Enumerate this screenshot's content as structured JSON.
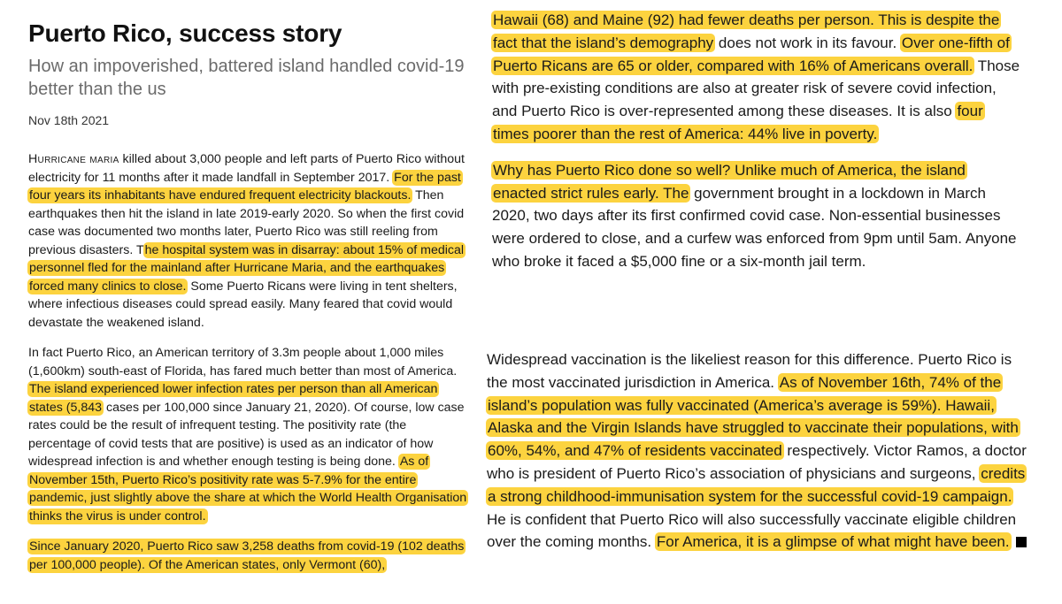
{
  "article": {
    "title": "Puerto Rico, success story",
    "subtitle": "How an impoverished, battered island handled covid-19 better than the us",
    "date": "Nov 18th 2021"
  },
  "p1": {
    "dropcap": "Hurricane maria",
    "t1": " killed about 3,000 people and left parts of Puerto Rico without electricity for 11 months after it made landfall in September 2017. ",
    "h1": "For the past four years its inhabitants have endured frequent electricity blackouts.",
    "t2": " Then earthquakes then hit the island in late 2019-early 2020. So when the first covid case was documented two months later, Puerto Rico was still reeling from previous disasters. T",
    "h2": "he hospital system was in disarray: about 15% of medical personnel fled for the mainland after Hurricane Maria, and the earthquakes forced many clinics to close.",
    "t3": " Some Puerto Ricans were living in tent shelters, where infectious diseases could spread easily. Many feared that covid would devastate the weakened island."
  },
  "p2": {
    "t1": "In fact Puerto Rico, an American territory of 3.3m people about 1,000 miles (1,600km) south-east of Florida, has fared much better than most of America. ",
    "h1": "The island experienced lower infection rates per person than all American states (5,843",
    "t2": " cases per 100,000 since January 21, 2020). Of course, low case rates could be the result of infrequent testing. The positivity rate (the percentage of covid tests that are positive) is used as an indicator of how widespread infection is and whether enough testing is being done. ",
    "h2": "As of November 15th, Puerto Rico’s positivity rate was 5-7.9% for the entire pandemic, just slightly above the share at which the World Health Organisation thinks the virus is under control."
  },
  "p3": {
    "h1": "Since January 2020, Puerto Rico saw 3,258 deaths from covid-19 (102 deaths per 100,000 people). Of the American states, only Vermont (60),"
  },
  "p4": {
    "h1": "Hawaii (68) and Maine (92) had fewer deaths per person. This is despite the fact that the island’s demography",
    "t1": " does not work in its favour. ",
    "h2": "Over one-fifth of Puerto Ricans are 65 or older, compared with 16% of Americans overall.",
    "t2": " Those with pre-existing conditions are also at greater risk of severe covid infection, and Puerto Rico is over-represented among these diseases. It is also ",
    "h3": "four times poorer than the rest of America: 44% live in poverty."
  },
  "p5": {
    "h1": "Why has Puerto Rico done so well? Unlike much of America, the island enacted strict rules early. The",
    "t1": " government brought in a lockdown in March 2020, two days after its first confirmed covid case. Non-essential businesses were ordered to close, and a curfew was enforced from 9pm until 5am. Anyone who broke it faced a $5,000 fine or a six-month jail term."
  },
  "p6": {
    "t1": "Widespread vaccination is the likeliest reason for this difference. Puerto Rico is the most vaccinated jurisdiction in America. ",
    "h1": "As of November 16th, 74% of the island’s population was fully vaccinated (America’s average is 59%). Hawaii, Alaska and the Virgin Islands have struggled to vaccinate their populations, with 60%, 54%, and 47% of residents vaccinated",
    "t2": " respectively. Victor Ramos, a doctor who is president of Puerto Rico’s association of physicians and surgeons, ",
    "h2": "credits a strong childhood-immunisation system for the successful covid-19 campaign.",
    "t3": " He is confident that Puerto Rico will also successfully vaccinate eligible children over the coming months. ",
    "h3": "For America, it is a glimpse of what might have been."
  },
  "colors": {
    "highlight": "#fcd33f",
    "subtitle": "#6b6b6b",
    "text": "#1a1a1a"
  }
}
